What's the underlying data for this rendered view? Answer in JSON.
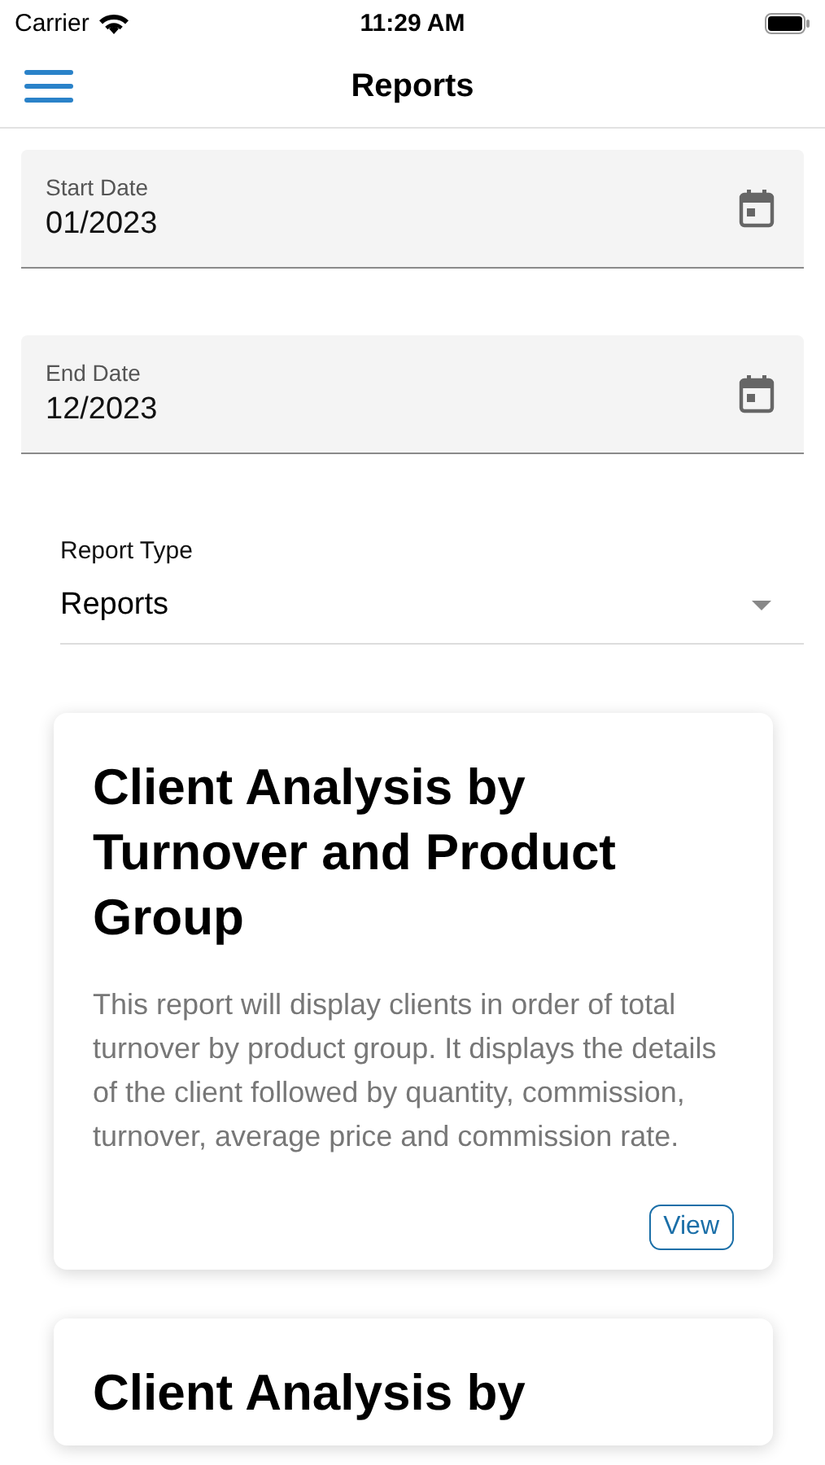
{
  "status_bar": {
    "carrier": "Carrier",
    "time": "11:29 AM"
  },
  "nav": {
    "title": "Reports"
  },
  "date_fields": [
    {
      "label": "Start Date",
      "value": "01/2023"
    },
    {
      "label": "End Date",
      "value": "12/2023"
    }
  ],
  "report_type": {
    "label": "Report Type",
    "value": "Reports"
  },
  "cards": [
    {
      "title": "Client Analysis by Turnover and Product Group",
      "description": "This report will display clients in order of total turnover by product group. It displays the details of the client followed by quantity, commission, turnover, average price and commission rate.",
      "button": "View"
    },
    {
      "title": "Client Analysis by"
    }
  ]
}
